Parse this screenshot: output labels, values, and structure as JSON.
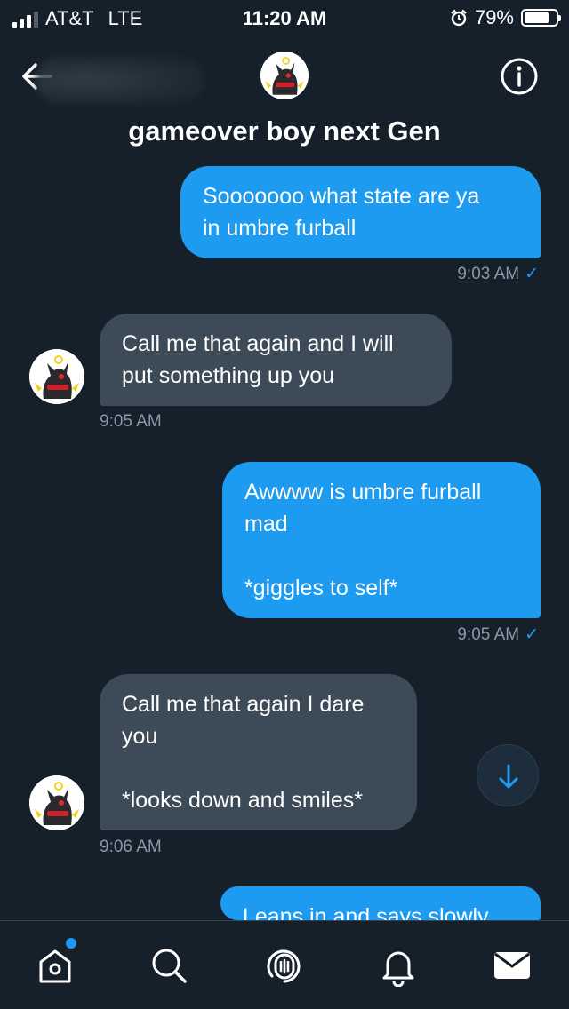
{
  "status_bar": {
    "carrier": "AT&T",
    "network": "LTE",
    "time": "11:20 AM",
    "battery_percent": "79%",
    "battery_level": 0.79,
    "signal_icon": "signal-bars-icon",
    "alarm_icon": "alarm-clock-icon"
  },
  "header": {
    "title": "gameover boy next Gen",
    "back_icon": "arrow-left-icon",
    "info_icon": "info-circle-icon"
  },
  "messages": [
    {
      "direction": "sent",
      "text": "Sooooooo what state are ya\nin umbre furball",
      "time": "9:03 AM",
      "read_mark": "✓"
    },
    {
      "direction": "received",
      "text": "Call me that again and I will\nput something up you",
      "time": "9:05 AM"
    },
    {
      "direction": "sent",
      "text": "Awwww is umbre furball\nmad\n\n*giggles to self*",
      "time": "9:05 AM",
      "read_mark": "✓"
    },
    {
      "direction": "received",
      "text": "Call me that again I dare\nyou\n\n*looks down and smiles*",
      "time": "9:06 AM"
    },
    {
      "direction": "sent",
      "text": "Leans in and says slowly"
    }
  ],
  "scroll_down_icon": "arrow-down-icon",
  "tabbar": {
    "items": [
      "home-icon",
      "search-icon",
      "spaces-icon",
      "notifications-bell-icon",
      "messages-envelope-icon"
    ],
    "active": "messages-envelope-icon",
    "home_has_badge": true
  },
  "colors": {
    "background": "#15202b",
    "sent_bubble": "#1d9bf0",
    "received_bubble": "#3d4a57",
    "timestamp": "#8b98a5"
  }
}
